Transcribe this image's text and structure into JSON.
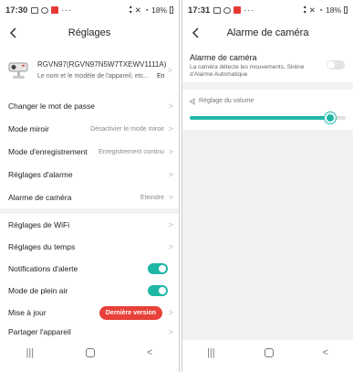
{
  "colors": {
    "accent": "#1fb7a6",
    "badge": "#e8413a",
    "background": "#f2f2f2"
  },
  "left": {
    "status": {
      "time": "17:30",
      "dots": "···",
      "signal_text": "18%"
    },
    "nav": {
      "title": "Réglages"
    },
    "device": {
      "name": "RGVN97(RGVN97N5W7TXEWV1111A)",
      "desc": "Le nom et le modèle de l'appareil, etc...",
      "more": "En"
    },
    "group1": [
      {
        "label": "Changer le mot de passe",
        "value": ""
      },
      {
        "label": "Mode miroir",
        "value": "Désactivier le mode miroir"
      },
      {
        "label": "Mode d'enregistrement",
        "value": "Enregistrement continu"
      },
      {
        "label": "Réglages d'alarme",
        "value": ""
      },
      {
        "label": "Alarme de caméra",
        "value": "Eteindre"
      }
    ],
    "group2": [
      {
        "label": "Réglages de WiFi"
      },
      {
        "label": "Réglages du temps"
      },
      {
        "label": "Notifications d'alerte"
      },
      {
        "label": "Mode de plein air"
      },
      {
        "label": "Mise à jour",
        "badge": "Dernière version"
      },
      {
        "label": "Partager l'appareil"
      }
    ],
    "bottom_nav": [
      "recent-apps-icon",
      "home-icon",
      "back-icon"
    ]
  },
  "right": {
    "status": {
      "time": "17:31",
      "dots": "···",
      "signal_text": "18%"
    },
    "nav": {
      "title": "Alarme de caméra"
    },
    "camera_alarm": {
      "title": "Alarme de caméra",
      "desc": "La caméra détecte les mouvements, Sirène d'Alarme Automatique",
      "enabled": false
    },
    "volume": {
      "label": "Réglage du volume",
      "level": 0.9
    }
  }
}
